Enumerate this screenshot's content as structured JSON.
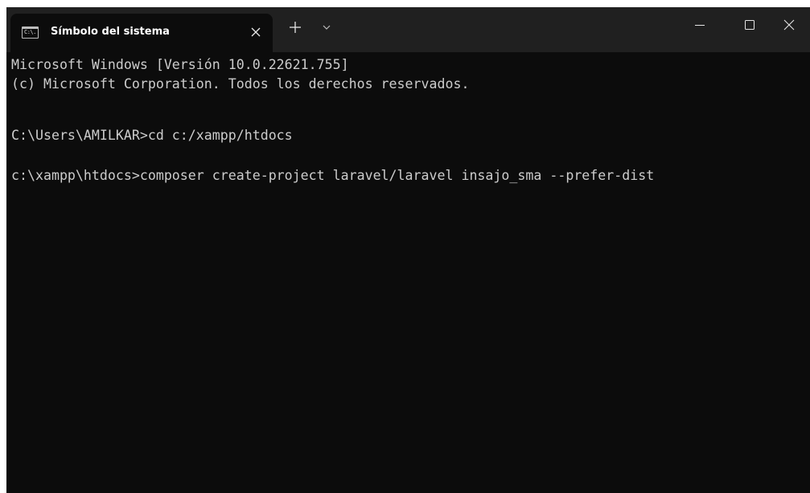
{
  "tab": {
    "icon": "console-app-icon",
    "icon_text": "C:\\.",
    "title": "Símbolo del sistema",
    "close_icon": "close-icon"
  },
  "titlebar": {
    "new_tab_icon": "plus-icon",
    "dropdown_icon": "chevron-down-icon",
    "window_controls": [
      "minimize-icon",
      "maximize-icon",
      "close-icon"
    ]
  },
  "console": {
    "lines": [
      "Microsoft Windows [Versión 10.0.22621.755]",
      "(c) Microsoft Corporation. Todos los derechos reservados.",
      "",
      "C:\\Users\\AMILKAR>cd c:/xampp/htdocs",
      "",
      "c:\\xampp\\htdocs>composer create-project laravel/laravel insajo_sma --prefer-dist"
    ]
  },
  "colors": {
    "titlebar_bg": "#202020",
    "console_bg": "#0c0c0c",
    "console_text": "#cccccc",
    "tab_text": "#ffffff"
  }
}
